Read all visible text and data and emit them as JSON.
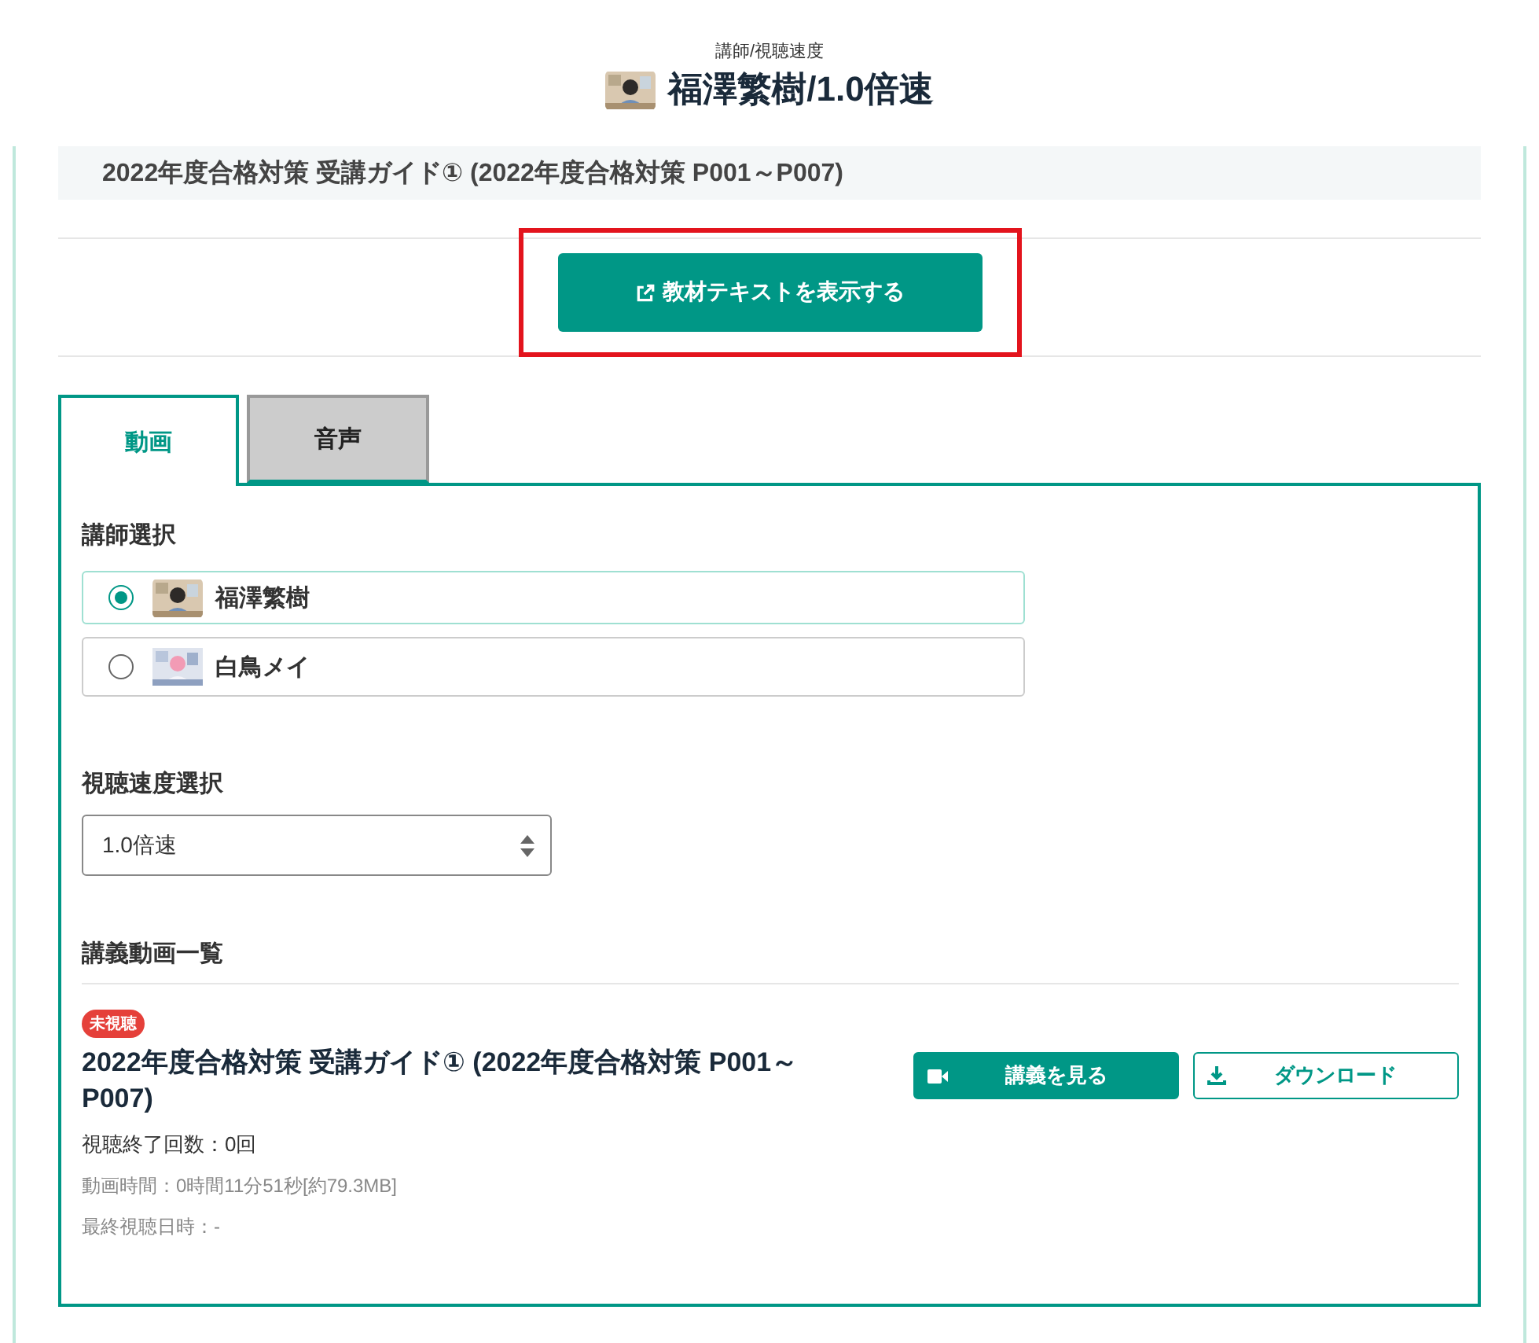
{
  "header": {
    "caption": "講師/視聴速度",
    "title": "福澤繁樹/1.0倍速"
  },
  "lesson_title": "2022年度合格対策 受講ガイド① (2022年度合格対策 P001～P007)",
  "text_button": {
    "label": "教材テキストを表示する",
    "highlighted": true
  },
  "tabs": [
    {
      "label": "動画",
      "selected": true
    },
    {
      "label": "音声",
      "selected": false
    }
  ],
  "teacher_section": {
    "heading": "講師選択",
    "options": [
      {
        "name": "福澤繁樹",
        "selected": true
      },
      {
        "name": "白鳥メイ",
        "selected": false
      }
    ]
  },
  "speed_section": {
    "heading": "視聴速度選択",
    "value": "1.0倍速"
  },
  "video_list": {
    "heading": "講義動画一覧",
    "items": [
      {
        "badge": "未視聴",
        "title": "2022年度合格対策 受講ガイド① (2022年度合格対策 P001～P007)",
        "play_count": "視聴終了回数：0回",
        "duration": "動画時間：0時間11分51秒[約79.3MB]",
        "last_viewed": "最終視聴日時：-",
        "watch_button": "講義を見る",
        "download_button": "ダウンロード"
      }
    ]
  }
}
